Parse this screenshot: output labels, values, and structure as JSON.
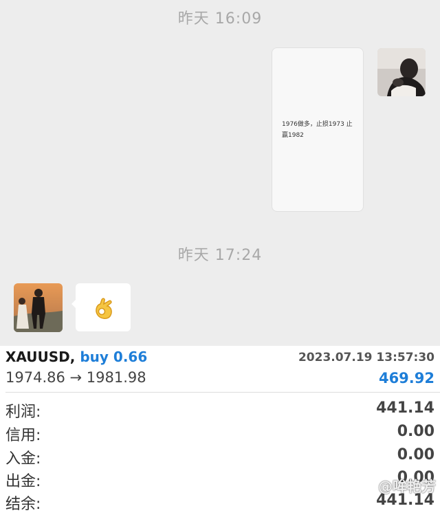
{
  "chat": {
    "timestamp_1": "昨天 16:09",
    "timestamp_2": "昨天 17:24",
    "outgoing_message": "1976做多，止损1973 止赢1982",
    "incoming_emoji_icon": "ok-hand-emoji"
  },
  "trade": {
    "symbol": "XAUUSD,",
    "direction_volume": "buy 0.66",
    "time": "2023.07.19 13:57:30",
    "price_range": "1974.86 → 1981.98",
    "trade_profit": "469.92",
    "rows": [
      {
        "label": "利润:",
        "value": "441.14"
      },
      {
        "label": "信用:",
        "value": "0.00"
      },
      {
        "label": "入金:",
        "value": "0.00"
      },
      {
        "label": "出金:",
        "value": "0.00"
      },
      {
        "label": "结余:",
        "value": "441.14"
      }
    ],
    "accent_color": "#1e7ed8"
  },
  "watermark": "@哞艳芳"
}
